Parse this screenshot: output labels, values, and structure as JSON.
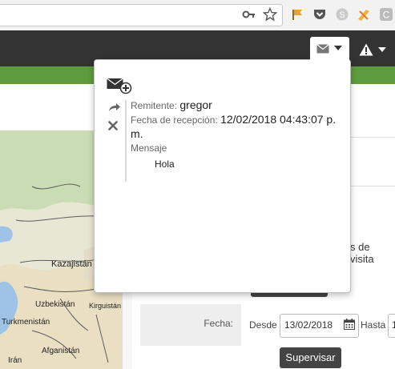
{
  "browser": {
    "icons": [
      "key-icon",
      "star-icon",
      "extension-flag-icon",
      "pocket-icon",
      "skype-icon",
      "tag-icon",
      "chrome-c-icon"
    ]
  },
  "appbar": {
    "mail_icon": "envelope-icon",
    "alert_icon": "warning-icon"
  },
  "popup": {
    "remitente_label": "Remitente:",
    "remitente_value": "gregor",
    "fecha_label": "Fecha de recepción:",
    "fecha_value": "12/02/2018 04:43:07 p. m.",
    "mensaje_label": "Mensaje",
    "mensaje_value": "Hola",
    "actions": [
      "compose-icon",
      "reply-icon",
      "delete-icon"
    ]
  },
  "map": {
    "labels": [
      "Kazajistán",
      "Uzbekistán",
      "Kirguistán",
      "Turkmenistán",
      "Afganistán",
      "Irán"
    ]
  },
  "form": {
    "visita_text": "s de visita",
    "fecha_label": "Fecha:",
    "desde_label": "Desde",
    "desde_value": "13/02/2018",
    "hasta_label": "Hasta",
    "hasta_value": "1",
    "supervisar_label": "Supervisar"
  },
  "colors": {
    "appbar": "#333333",
    "greenbar": "#5f9a3e",
    "button": "#444444"
  }
}
